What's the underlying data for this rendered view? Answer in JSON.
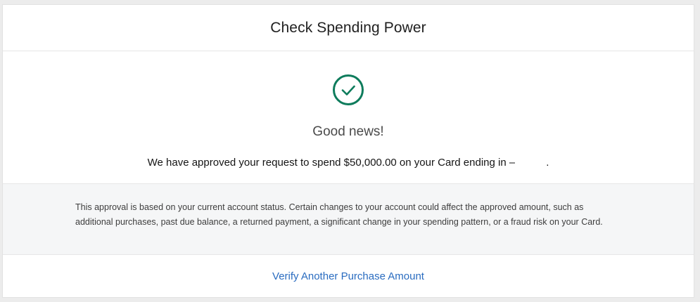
{
  "header": {
    "title": "Check Spending Power"
  },
  "result": {
    "icon": "check-circle-icon",
    "icon_color": "#0e7c5c",
    "headline": "Good news!",
    "message_prefix": "We have approved your request to spend $50,000.00 on your Card ending in –",
    "message_suffix": "."
  },
  "disclaimer": {
    "text": "This approval is based on your current account status. Certain changes to your account could affect the approved amount, such as additional purchases, past due balance, a returned payment, a significant change in your spending pattern, or a fraud risk on your Card."
  },
  "footer": {
    "link_label": "Verify Another Purchase Amount",
    "link_color": "#2a6cc0"
  }
}
